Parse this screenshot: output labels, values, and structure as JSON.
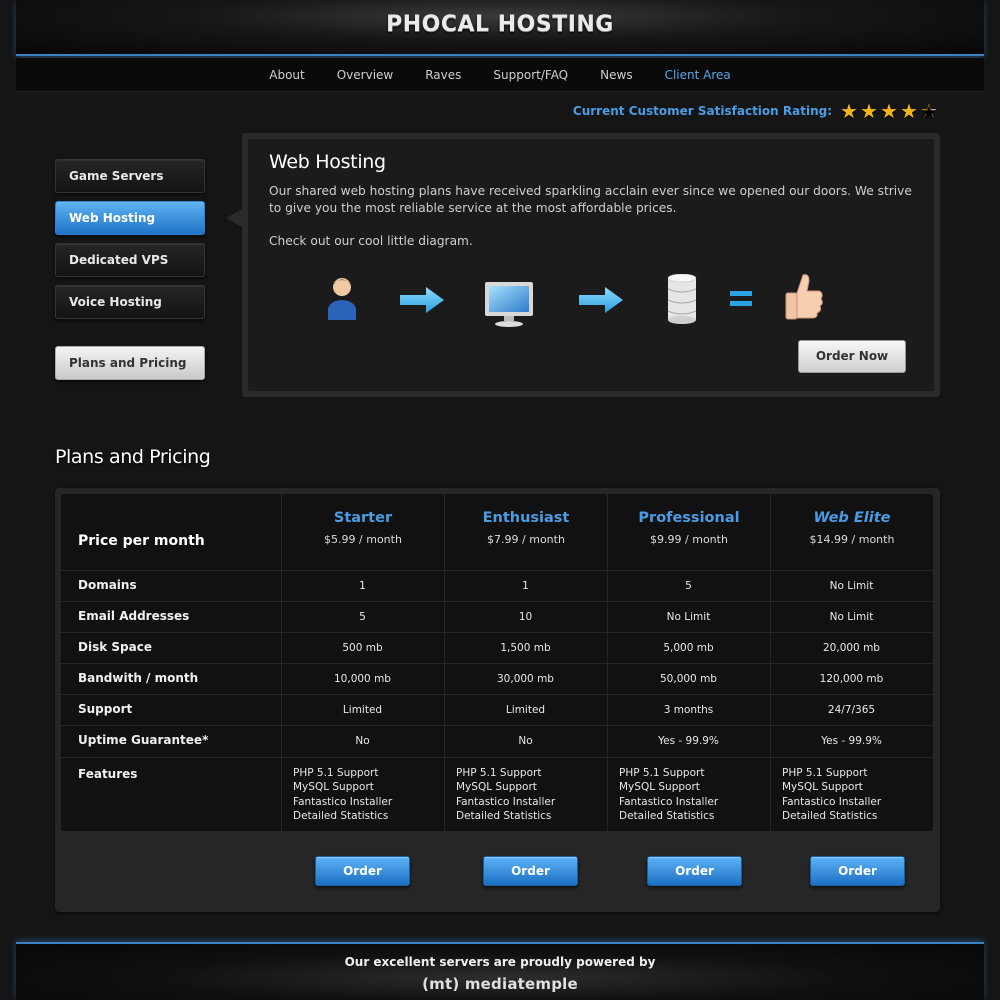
{
  "header": {
    "logo": "PHOCAL HOSTING"
  },
  "nav": {
    "items": [
      "About",
      "Overview",
      "Raves",
      "Support/FAQ",
      "News",
      "Client Area"
    ],
    "active": "Client Area"
  },
  "rating": {
    "label": "Current Customer Satisfaction Rating:",
    "stars": 4.5,
    "max": 5
  },
  "sidebar": {
    "items": [
      {
        "label": "Game Servers"
      },
      {
        "label": "Web Hosting"
      },
      {
        "label": "Dedicated VPS"
      },
      {
        "label": "Voice Hosting"
      },
      {
        "label": "Plans and Pricing"
      }
    ],
    "active": "Web Hosting"
  },
  "panel": {
    "title": "Web Hosting",
    "description": "Our shared web hosting plans have received sparkling acclain ever since we opened our doors.  We strive to give you the most reliable service at the most affordable prices.",
    "diagram_caption": "Check out our cool little diagram.",
    "diagram_icons": [
      "user-icon",
      "arrow-right-icon",
      "computer-monitor-icon",
      "arrow-right-icon",
      "database-icon",
      "equals-icon",
      "thumbs-up-icon"
    ],
    "order_now": "Order Now"
  },
  "plans": {
    "title": "Plans and Pricing",
    "price_label": "Price per month",
    "columns": [
      {
        "name": "Starter",
        "price": "$5.99 / month"
      },
      {
        "name": "Enthusiast",
        "price": "$7.99 / month"
      },
      {
        "name": "Professional",
        "price": "$9.99 / month"
      },
      {
        "name": "Web Elite",
        "price": "$14.99 / month"
      }
    ],
    "rows": [
      {
        "label": "Domains",
        "values": [
          "1",
          "1",
          "5",
          "No Limit"
        ]
      },
      {
        "label": "Email Addresses",
        "values": [
          "5",
          "10",
          "No Limit",
          "No Limit"
        ]
      },
      {
        "label": "Disk Space",
        "values": [
          "500 mb",
          "1,500 mb",
          "5,000 mb",
          "20,000 mb"
        ]
      },
      {
        "label": "Bandwith / month",
        "values": [
          "10,000 mb",
          "30,000 mb",
          "50,000 mb",
          "120,000 mb"
        ]
      },
      {
        "label": "Support",
        "values": [
          "Limited",
          "Limited",
          "3 months",
          "24/7/365"
        ]
      },
      {
        "label": "Uptime Guarantee*",
        "values": [
          "No",
          "No",
          "Yes - 99.9%",
          "Yes - 99.9%"
        ]
      }
    ],
    "features_label": "Features",
    "features": [
      "PHP 5.1 Support",
      "MySQL Support",
      "Fantastico Installer",
      "Detailed Statistics"
    ],
    "order_label": "Order"
  },
  "footer": {
    "text": "Our excellent servers are proudly powered by",
    "logo": "(mt) mediatemple"
  }
}
